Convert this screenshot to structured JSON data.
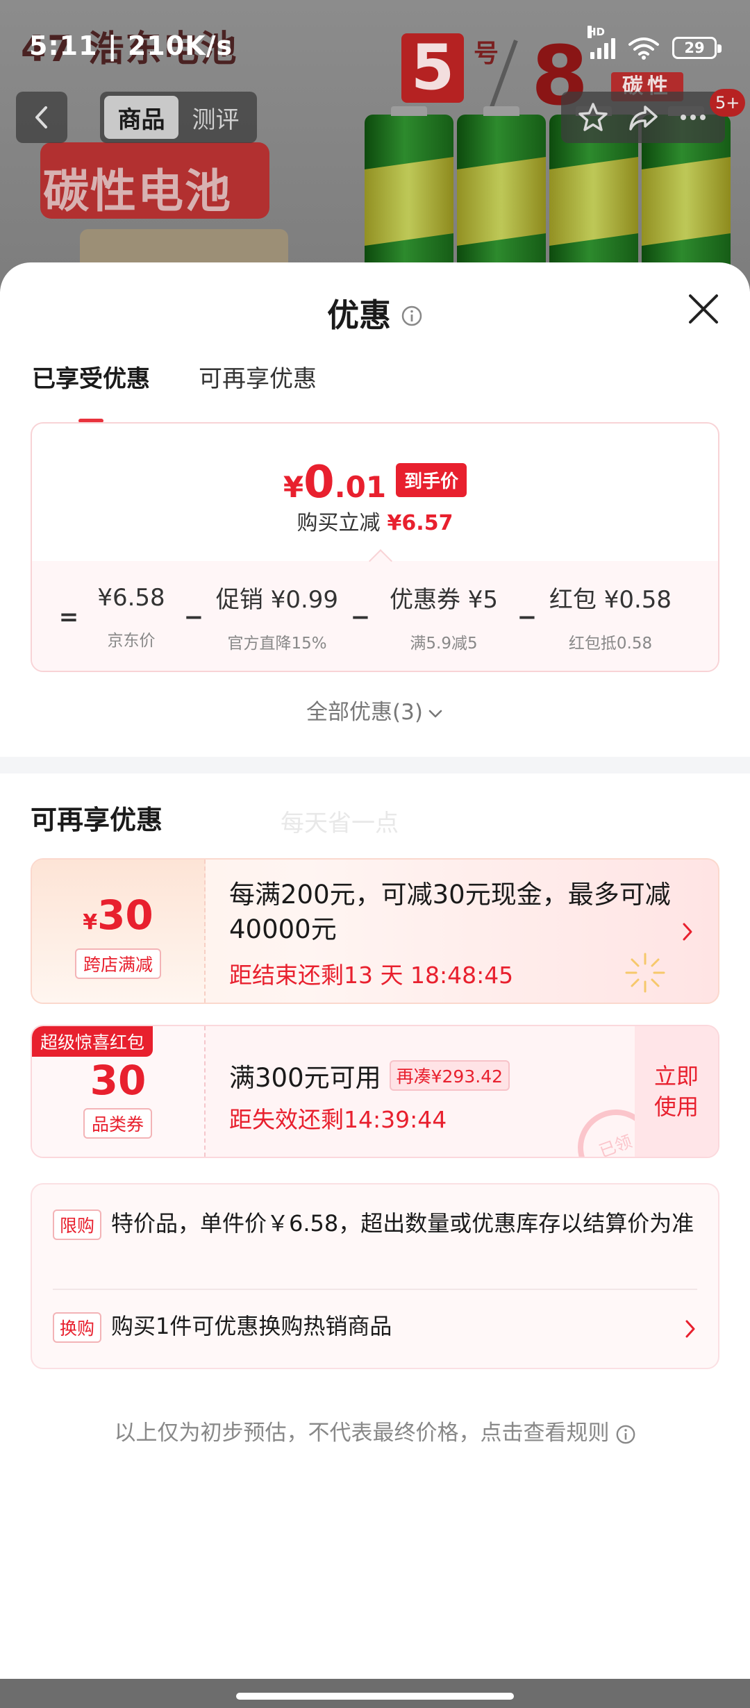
{
  "status_bar": {
    "time": "5:11 | 210K/s",
    "network_label": "HD",
    "battery_level": "29"
  },
  "background": {
    "brand_mark": "47 浩东电池",
    "size_number": "5",
    "size_suffix": "号",
    "size_number_alt": "8",
    "carbon_tag": "碳性",
    "product_title": "碳性电池",
    "nav_tabs": [
      "商品",
      "测评"
    ],
    "active_nav_tab": 0,
    "message_badge": "5+"
  },
  "sheet": {
    "title": "优惠",
    "tabs": [
      "已享受优惠",
      "可再享优惠"
    ],
    "active_tab": 0
  },
  "price_card": {
    "currency": "¥",
    "price_integer": "0",
    "price_decimal": ".01",
    "price_tag": "到手价",
    "reduce_label": "购买立减",
    "reduce_value": "¥6.57",
    "calc": [
      {
        "op": "=",
        "value": "¥6.58",
        "sub": "京东价"
      },
      {
        "op": "−",
        "value": "促销 ¥0.99",
        "sub": "官方直降15%"
      },
      {
        "op": "−",
        "value": "优惠券 ¥5",
        "sub": "满5.9减5"
      },
      {
        "op": "−",
        "value": "红包 ¥0.58",
        "sub": "红包抵0.58"
      }
    ]
  },
  "all_promotions": "全部优惠(3)",
  "more_section": {
    "title": "可再享优惠",
    "watermark": "每天省一点"
  },
  "coupon_cross_store": {
    "currency": "¥",
    "amount": "30",
    "tag": "跨店满减",
    "description": "每满200元，可减30元现金，最多可减40000元",
    "timer": "距结束还剩13 天 18:48:45"
  },
  "coupon_category": {
    "ribbon": "超级惊喜红包",
    "amount": "30",
    "tag": "品类券",
    "condition": "满300元可用",
    "extra": "再凑¥293.42",
    "timer": "距失效还剩14:39:44",
    "use_button": "立即使用",
    "stamp": "已领"
  },
  "rules": [
    {
      "tag": "限购",
      "text": "特价品，单件价￥6.58，超出数量或优惠库存以结算价为准"
    },
    {
      "tag": "换购",
      "text": "购买1件可优惠换购热销商品"
    }
  ],
  "disclaimer": "以上仅为初步预估，不代表最终价格，点击查看规则",
  "colors": {
    "accent_red": "#e8202e",
    "card_border": "#f8d3d6",
    "divider": "#f4f5f7"
  }
}
